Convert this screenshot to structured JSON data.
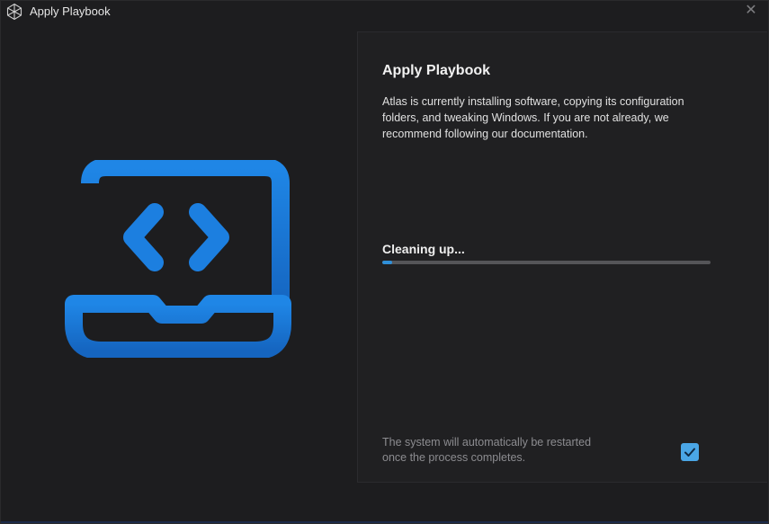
{
  "window": {
    "title": "Apply Playbook",
    "close_glyph": "✕",
    "app_icon": "atlas-logo-icon",
    "close_icon": "close-icon"
  },
  "illustration": {
    "icon": "laptop-code-icon",
    "color": "#1a74d4"
  },
  "main": {
    "heading": "Apply Playbook",
    "description": "Atlas is currently installing software, copying its configuration folders, and tweaking Windows. If you are not already, we recommend following our documentation.",
    "status": "Cleaning up...",
    "progress_fraction": 0.03,
    "restart_note": "The system will automatically be restarted once the process completes.",
    "restart_checkbox_checked": true
  },
  "colors": {
    "background": "#1d1d1f",
    "panel": "#202022",
    "accent": "#2f8fd8",
    "checkbox": "#4aa6e6"
  }
}
